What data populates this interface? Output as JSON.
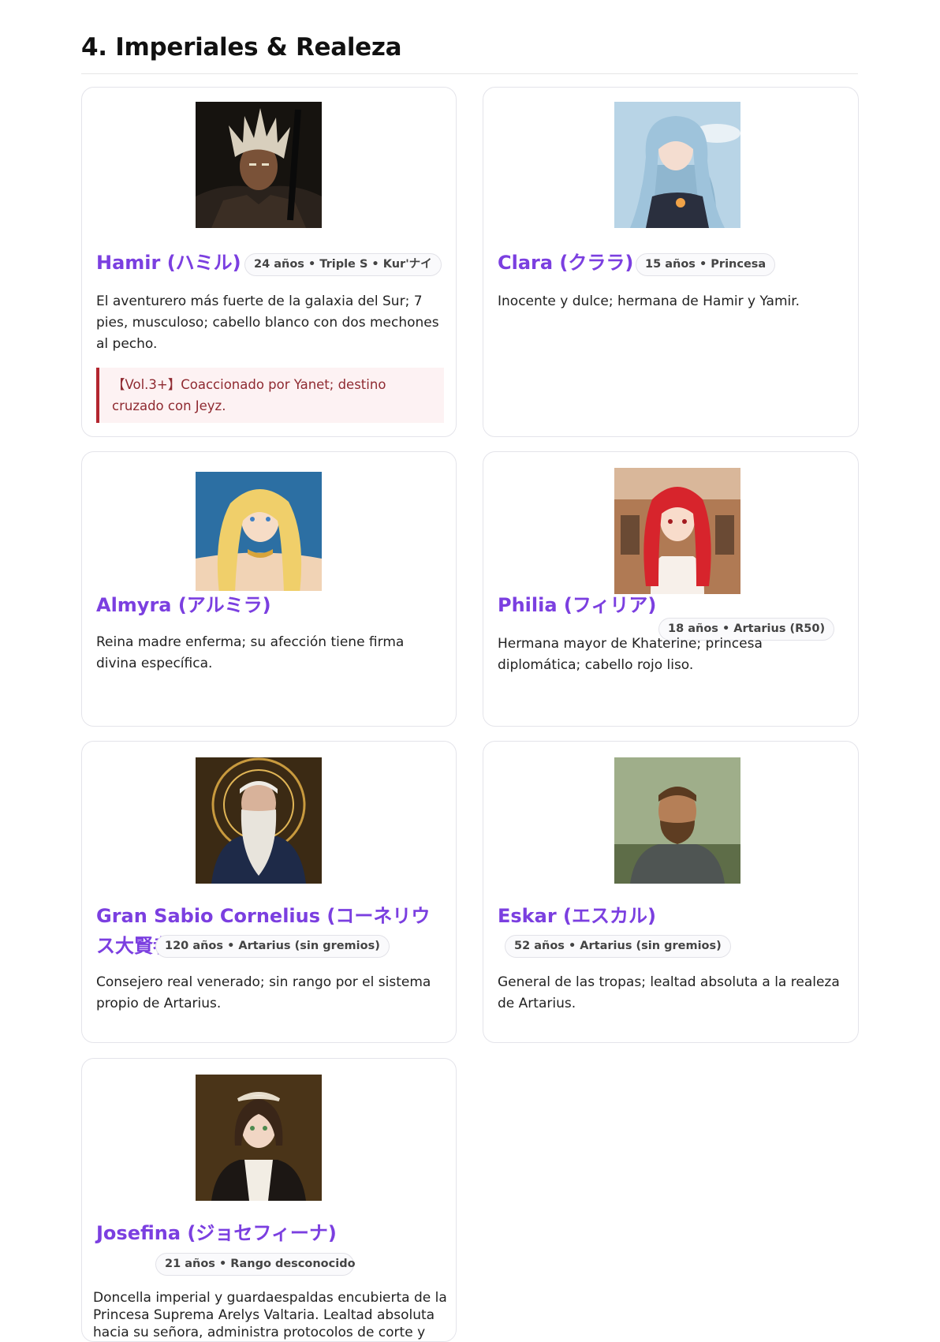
{
  "section": {
    "title": "4. Imperiales & Realeza"
  },
  "cards": [
    {
      "name": "Hamir (ハミル)",
      "badge": "24 años • Triple S • Kur'ナイ",
      "description": "El aventurero más fuerte de la galaxia del Sur; 7 pies, musculoso; cabello blanco con dos mechones al pecho.",
      "note": "【Vol.3+】Coaccionado por Yanet; destino cruzado con Jeyz.",
      "portrait": "dark-armored-warrior-portrait"
    },
    {
      "name": "Clara (クララ)",
      "badge": "15 años • Princesa",
      "description": "Inocente y dulce; hermana de Hamir y Yamir.",
      "portrait": "blue-haired-girl-portrait"
    },
    {
      "name": "Almyra (アルミラ)",
      "description": "Reina madre enferma; su afección tiene firma divina específica.",
      "portrait": "blonde-queen-portrait"
    },
    {
      "name": "Philia (フィリア)",
      "badge": "18 años • Artarius (R50)",
      "description": "Hermana mayor de Khaterine; princesa diplomática; cabello rojo liso.",
      "portrait": "red-haired-princess-portrait"
    },
    {
      "name": "Gran Sabio Cornelius (コーネリウス大賢者)",
      "badge": "120 años • Artarius (sin gremios)",
      "description": "Consejero real venerado; sin rango por el sistema propio de Artarius.",
      "portrait": "old-sage-portrait"
    },
    {
      "name": "Eskar (エスカル)",
      "badge": "52 años • Artarius (sin gremios)",
      "description": "General de las tropas; lealtad absoluta a la realeza de Artarius.",
      "portrait": "bearded-general-portrait"
    },
    {
      "name": "Josefina (ジョセフィーナ)",
      "badge": "21 años • Rango desconocido",
      "description": "Doncella imperial y guardaespaldas encubierta de la Princesa Suprema Arelys Valtaria. Lealtad absoluta hacia su señora, administra protocolos de corte y vela por",
      "portrait": "maid-portrait"
    }
  ]
}
